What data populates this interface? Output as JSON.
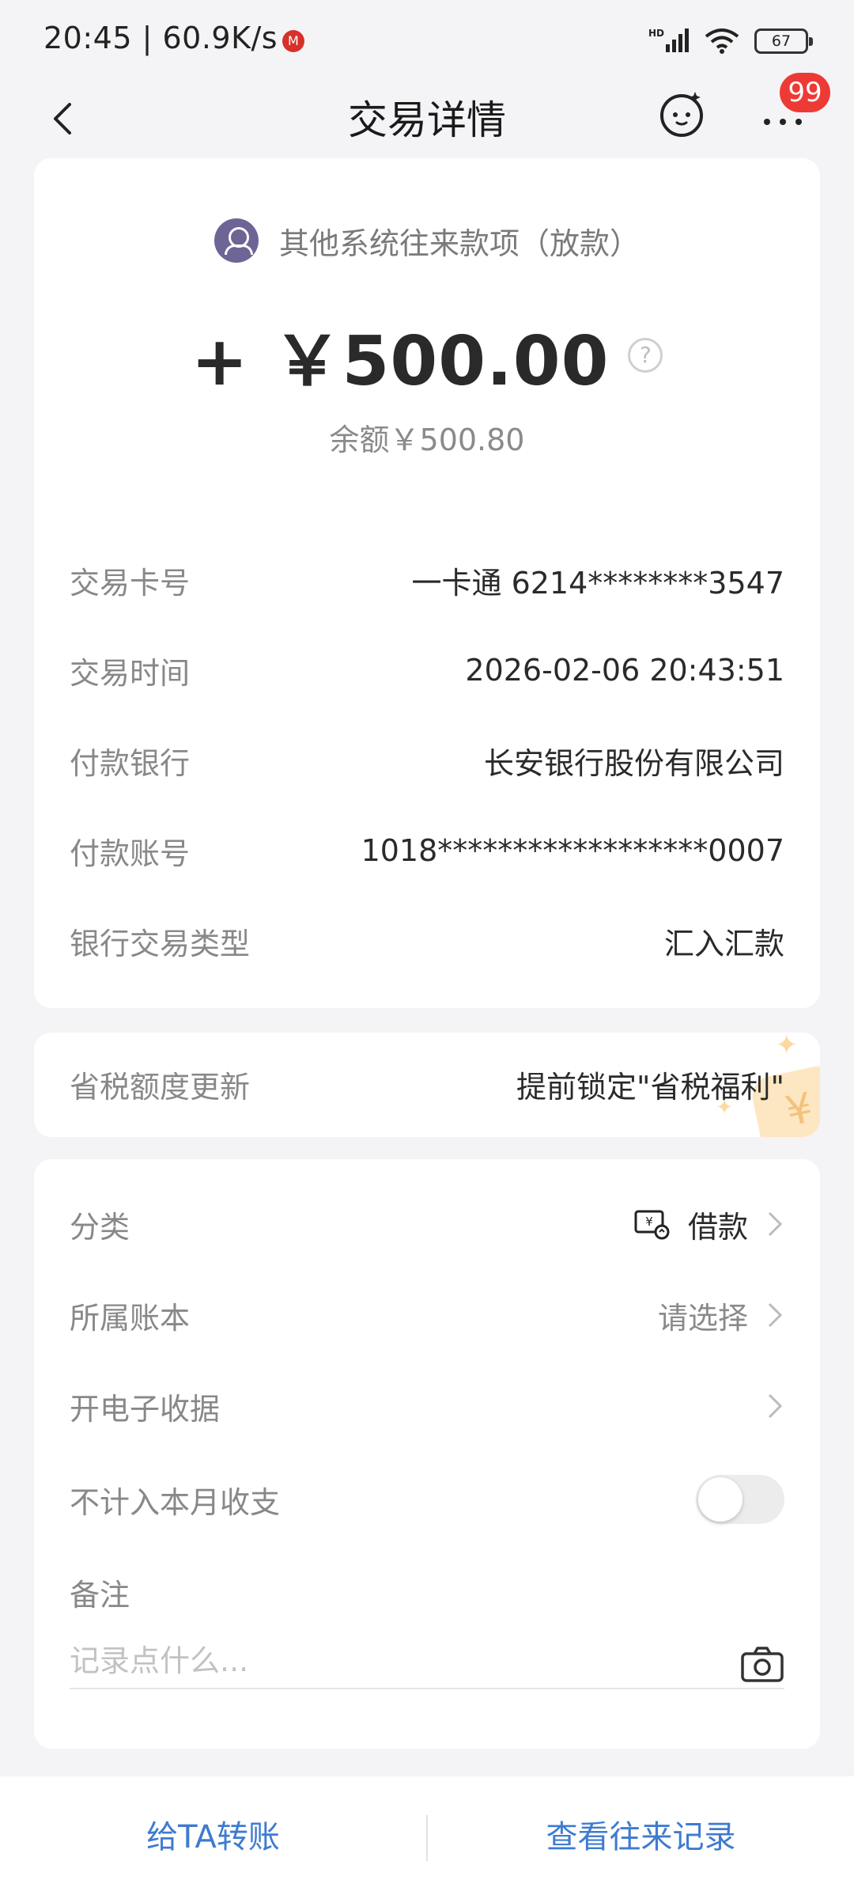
{
  "status_bar": {
    "time": "20:45 | 60.9K/s",
    "network_type": "HD",
    "battery": "67"
  },
  "nav": {
    "title": "交易详情",
    "badge": "99"
  },
  "counterparty": {
    "name": "其他系统往来款项（放款）"
  },
  "amount": "+ ￥500.00",
  "balance": "余额￥500.80",
  "details": [
    {
      "label": "交易卡号",
      "value": "一卡通 6214********3547"
    },
    {
      "label": "交易时间",
      "value": "2026-02-06 20:43:51"
    },
    {
      "label": "付款银行",
      "value": "长安银行股份有限公司"
    },
    {
      "label": "付款账号",
      "value": "1018******************0007"
    },
    {
      "label": "银行交易类型",
      "value": "汇入汇款"
    }
  ],
  "promo": {
    "label": "省税额度更新",
    "value": "提前锁定\"省税福利\""
  },
  "settings": {
    "category": {
      "label": "分类",
      "value": "借款"
    },
    "ledger": {
      "label": "所属账本",
      "value": "请选择"
    },
    "receipt": {
      "label": "开电子收据"
    },
    "exclude": {
      "label": "不计入本月收支",
      "enabled": false
    },
    "memo": {
      "label": "备注",
      "placeholder": "记录点什么..."
    }
  },
  "bottom": {
    "transfer": "给TA转账",
    "history": "查看往来记录"
  },
  "colors": {
    "accent": "#3f7bd0",
    "badge": "#ee3a35",
    "avatar": "#6e6596"
  }
}
